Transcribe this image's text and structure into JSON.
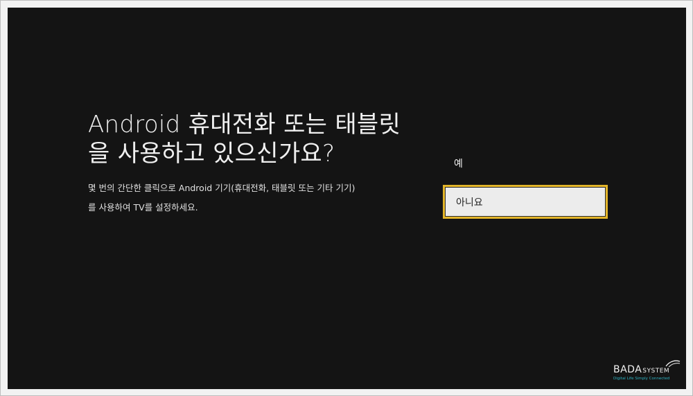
{
  "screen": {
    "title": "Android 휴대전화 또는 태블릿을 사용하고 있으신가요?",
    "description_line1": "몇 번의 간단한 클릭으로 Android 기기(휴대전화, 태블릿 또는 기타 기기)",
    "description_line2": "를 사용하여 TV를 설정하세요."
  },
  "options": {
    "yes_label": "예",
    "no_label": "아니요",
    "selected": "no"
  },
  "watermark": {
    "brand_main": "BADA",
    "brand_sub": "SYSTEM",
    "tagline": "Digital Life Simply Connected"
  },
  "colors": {
    "background": "#141414",
    "focus_border": "#e3b52a",
    "selected_bg": "#ececec",
    "watermark_accent": "#2fb6c6"
  }
}
